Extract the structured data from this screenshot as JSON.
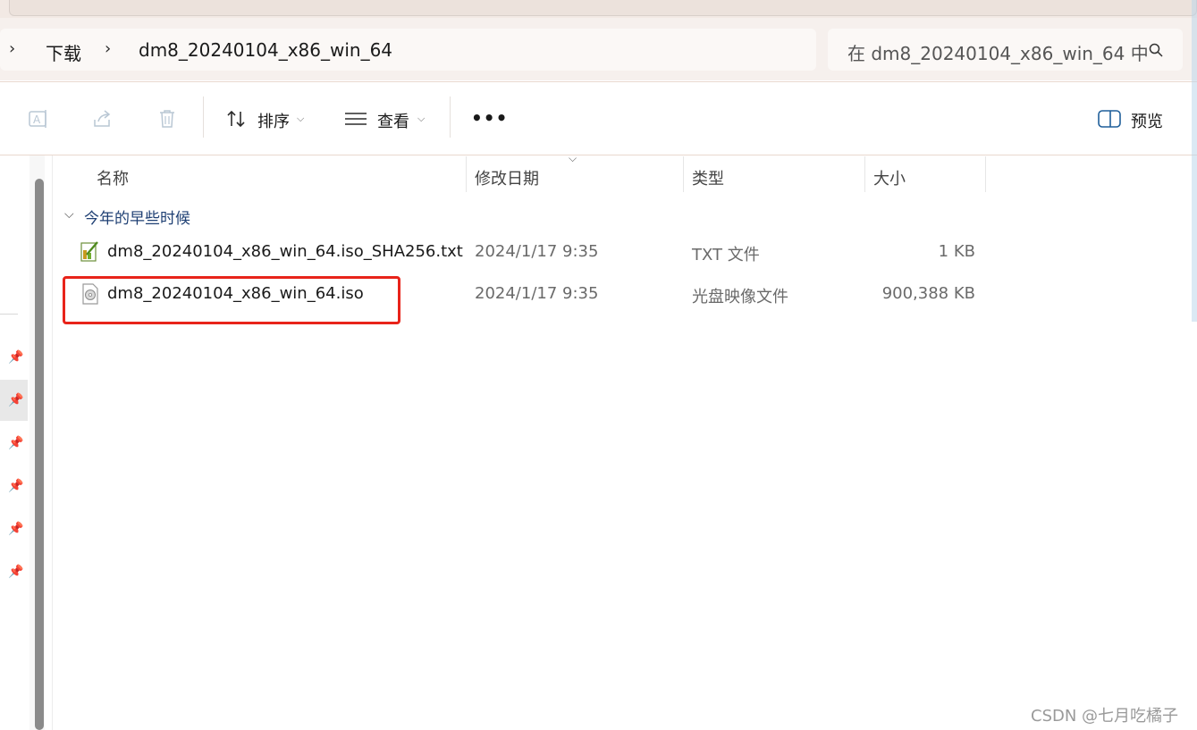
{
  "breadcrumb": {
    "items": [
      "下载",
      "dm8_20240104_x86_win_64"
    ]
  },
  "search": {
    "placeholder": "在 dm8_20240104_x86_win_64 中"
  },
  "toolbar": {
    "sort_label": "排序",
    "view_label": "查看",
    "more_label": "•••",
    "preview_label": "预览"
  },
  "columns": {
    "name": "名称",
    "modified": "修改日期",
    "type": "类型",
    "size": "大小"
  },
  "groups": [
    {
      "label": "今年的早些时候",
      "files": [
        {
          "name": "dm8_20240104_x86_win_64.iso_SHA256.txt",
          "modified": "2024/1/17 9:35",
          "type": "TXT 文件",
          "size": "1 KB",
          "icon": "text-file-icon"
        },
        {
          "name": "dm8_20240104_x86_win_64.iso",
          "modified": "2024/1/17 9:35",
          "type": "光盘映像文件",
          "size": "900,388 KB",
          "icon": "disc-image-icon"
        }
      ]
    }
  ],
  "annotation": {
    "color": "#e8231a"
  },
  "watermark": "CSDN @七月吃橘子"
}
